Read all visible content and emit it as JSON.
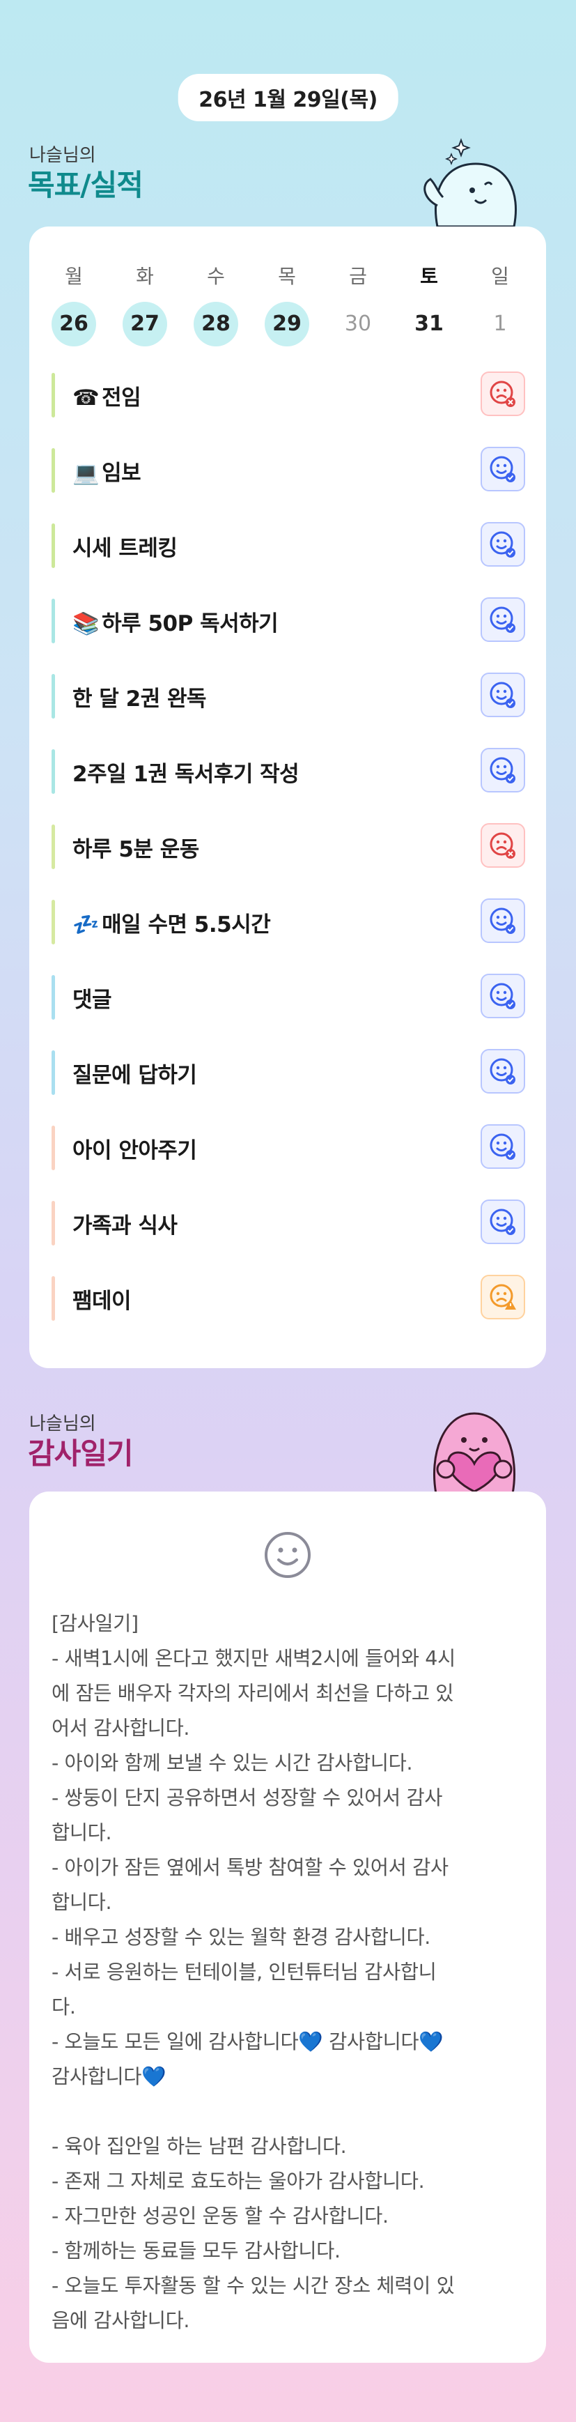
{
  "header": {
    "date": "26년 1월 29일(목)"
  },
  "goals_section": {
    "subtitle": "나슬님의",
    "title": "목표/실적"
  },
  "week": [
    {
      "name": "월",
      "num": "26",
      "state": "done"
    },
    {
      "name": "화",
      "num": "27",
      "state": "done"
    },
    {
      "name": "수",
      "num": "28",
      "state": "done"
    },
    {
      "name": "목",
      "num": "29",
      "state": "done"
    },
    {
      "name": "금",
      "num": "30",
      "state": "future"
    },
    {
      "name": "토",
      "num": "31",
      "state": "current"
    },
    {
      "name": "일",
      "num": "1",
      "state": "future"
    }
  ],
  "goals": [
    {
      "emoji": "☎",
      "label": "전임",
      "status": "fail",
      "bar_color": "#cde89a"
    },
    {
      "emoji": "💻",
      "label": "임보",
      "status": "ok",
      "bar_color": "#cde89a"
    },
    {
      "emoji": "",
      "label": "시세 트레킹",
      "status": "ok",
      "bar_color": "#cde89a"
    },
    {
      "emoji": "📚",
      "label": "하루 50P 독서하기",
      "status": "ok",
      "bar_color": "#a9e6e4"
    },
    {
      "emoji": "",
      "label": "한 달 2권 완독",
      "status": "ok",
      "bar_color": "#a9e6e4"
    },
    {
      "emoji": "",
      "label": "2주일 1권 독서후기 작성",
      "status": "ok",
      "bar_color": "#a9e6e4"
    },
    {
      "emoji": "",
      "label": "하루 5분 운동",
      "status": "fail",
      "bar_color": "#d6e9a1"
    },
    {
      "emoji": "💤",
      "label": "매일 수면 5.5시간",
      "status": "ok",
      "bar_color": "#d6e9a1"
    },
    {
      "emoji": "",
      "label": "댓글",
      "status": "ok",
      "bar_color": "#a9dff0"
    },
    {
      "emoji": "",
      "label": "질문에 답하기",
      "status": "ok",
      "bar_color": "#a9dff0"
    },
    {
      "emoji": "",
      "label": "아이 안아주기",
      "status": "ok",
      "bar_color": "#fad3c2"
    },
    {
      "emoji": "",
      "label": "가족과 식사",
      "status": "ok",
      "bar_color": "#fad3c2"
    },
    {
      "emoji": "",
      "label": "팸데이",
      "status": "warn",
      "bar_color": "#fad3c2"
    }
  ],
  "thanks_section": {
    "subtitle": "나슬님의",
    "title": "감사일기"
  },
  "thanks": {
    "text": "[감사일기]\n- 새벽1시에 온다고 했지만 새벽2시에 들어와 4시\n에 잠든 배우자 각자의 자리에서 최선을 다하고 있\n어서 감사합니다.\n- 아이와 함께 보낼 수 있는 시간 감사합니다.\n- 쌍둥이 단지 공유하면서 성장할 수 있어서 감사\n합니다.\n- 아이가 잠든 옆에서 톡방 참여할 수 있어서 감사\n합니다.\n- 배우고 성장할 수 있는 월학 환경 감사합니다.\n- 서로 응원하는 턴테이블, 인턴튜터님 감사합니\n다.\n- 오늘도 모든 일에 감사합니다💙 감사합니다💙\n감사합니다💙\n\n- 육아 집안일 하는 남편 감사합니다.\n- 존재 그 자체로 효도하는 울아가 감사합니다.\n- 자그만한 성공인 운동 할 수 감사합니다.\n- 함께하는 동료들 모두 감사합니다.\n- 오늘도 투자활동 할 수 있는 시간 장소 체력이 있\n음에 감사합니다."
  },
  "icons": {
    "ok": "smile-check-icon",
    "fail": "frown-x-icon",
    "warn": "frown-warning-icon"
  },
  "colors": {
    "done_day": "#c6f0f2",
    "ok": "#3b63f0",
    "fail": "#e04545",
    "warn": "#f39a2b",
    "goal_title": "#0f8a8c",
    "thanks_title": "#a0226a"
  }
}
